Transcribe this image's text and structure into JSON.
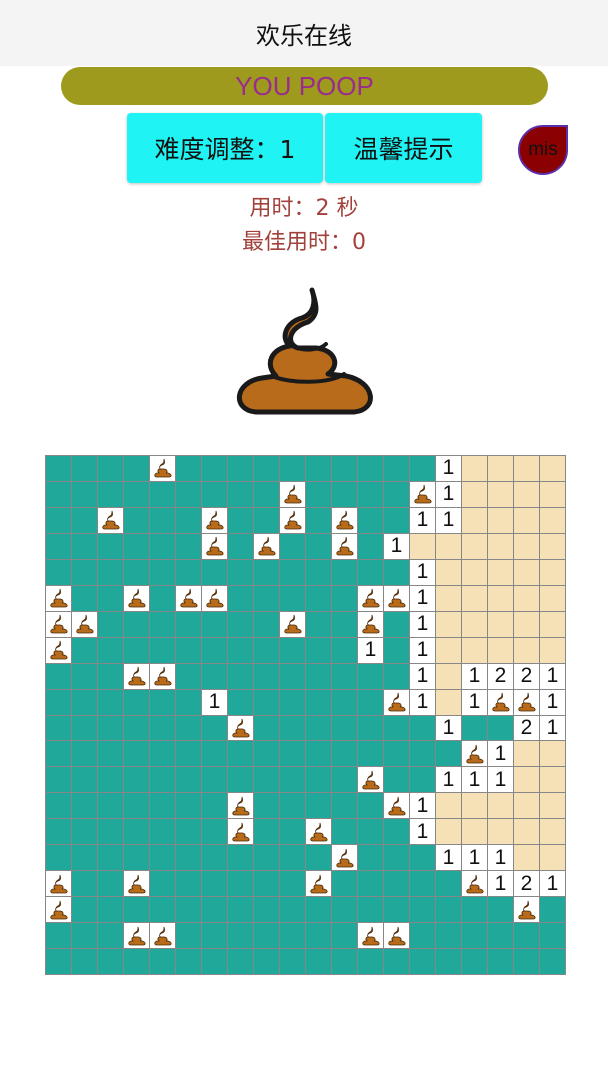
{
  "app": {
    "title": "欢乐在线"
  },
  "status": {
    "message": "YOU POOP"
  },
  "buttons": {
    "difficulty": "难度调整：1",
    "hint": "温馨提示",
    "mis": "mis"
  },
  "timer": {
    "used": "用时：2 秒",
    "best": "最佳用时：0"
  },
  "colors": {
    "covered": "#20a89a",
    "open": "#f6e0b6",
    "revealed": "#ffffff",
    "status_bar": "#9d9a1e",
    "status_text": "#9b2c8d",
    "button": "#1ff3f3",
    "timer_text": "#a2413b",
    "mis_button": "#8b0000"
  },
  "board": {
    "rows": 20,
    "cols": 20,
    "poop_icon": "poop-icon",
    "face_icon": "poop-face-icon",
    "legend": {
      "C": "covered",
      "O": "open",
      "P": "poop",
      "1-8": "number"
    },
    "grid": [
      "CCCCPCCCCCCCCCC1OOOO",
      "CCCCCCCCCPCCCCP1OOOO",
      "CCPCCCPCCPCPCC11OOOO",
      "CCCCCCPCPCCPC1OOOOOO",
      "CCCCCCCCCCCCCC1OOOOO",
      "PCCPCPPCCCCCPP1OOOOO",
      "PPCCCCCCCPCCPC1OOOOO",
      "PCCCCCCCCCCC1C1OOOOO",
      "CCCPPCCCCCCCCC1O1221",
      "CCCCCC1CCCCCCP1O1PP1",
      "CCCCCCCPCCCCCCC1CC21",
      "CCCCCCCCCCCCCCCCP1OO",
      "CCCCCCCCCCCCPCC111OO",
      "CCCCCCCPCCCCCP1OOOOO",
      "CCCCCCCPCCPCCC1OOOOO",
      "CCCCCCCCCCCPCCC111OO",
      "PCCPCCCCCCPCCCCCP121",
      "PCCCCCCCCCCCCCCCCCPC",
      "CCCPPCCCCCCCPPCCCCCC",
      "CCCCCCCCCCCCCCCCCCCC"
    ]
  }
}
